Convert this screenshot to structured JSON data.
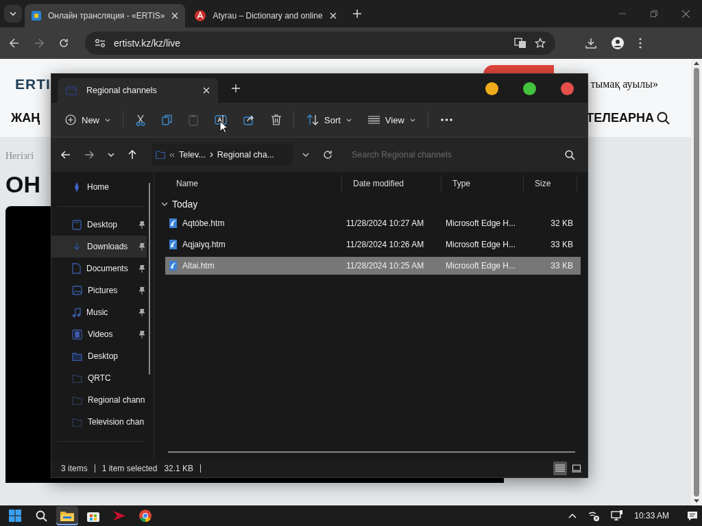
{
  "browser": {
    "tabs": [
      {
        "title": "Онлайн трансляция - «ERTIS»",
        "selected": true
      },
      {
        "title": "Atyrau – Dictionary and online",
        "selected": false
      }
    ],
    "url": "ertistv.kz/kz/live"
  },
  "page": {
    "logo": "ERTI",
    "headline": "тымақ ауылы»",
    "nav_left": "ЖАҢ",
    "nav_right": "ТЕЛЕАРНА",
    "breadcrumb": "Негізгі",
    "heading": "ОН"
  },
  "explorer": {
    "tab_title": "Regional channels",
    "commands": [
      {
        "kind": "new",
        "label": "New"
      },
      {
        "kind": "cut"
      },
      {
        "kind": "copy"
      },
      {
        "kind": "paste",
        "disabled": true
      },
      {
        "kind": "rename"
      },
      {
        "kind": "share"
      },
      {
        "kind": "delete"
      },
      {
        "kind": "sort",
        "label": "Sort"
      },
      {
        "kind": "view",
        "label": "View"
      },
      {
        "kind": "more"
      }
    ],
    "path": [
      "Telev...",
      "Regional cha..."
    ],
    "search": {
      "placeholder": "Search Regional channels"
    },
    "nav": [
      {
        "kind": "home",
        "label": "Home",
        "selected": false
      },
      {
        "kind": "desktop",
        "label": "Desktop",
        "pinned": true,
        "selected": false
      },
      {
        "kind": "downloads",
        "label": "Downloads",
        "pinned": true,
        "selected": true
      },
      {
        "kind": "documents",
        "label": "Documents",
        "pinned": true,
        "selected": false
      },
      {
        "kind": "pictures",
        "label": "Pictures",
        "pinned": true,
        "selected": false
      },
      {
        "kind": "music",
        "label": "Music",
        "pinned": true,
        "selected": false
      },
      {
        "kind": "videos",
        "label": "Videos",
        "pinned": true,
        "selected": false
      },
      {
        "kind": "desktop-folder",
        "label": "Desktop",
        "selected": false
      },
      {
        "kind": "folder",
        "label": "QRTC",
        "selected": false
      },
      {
        "kind": "folder",
        "label": "Regional chann",
        "selected": false
      },
      {
        "kind": "folder",
        "label": "Television chan",
        "selected": false
      }
    ],
    "columns": [
      "Name",
      "Date modified",
      "Type",
      "Size"
    ],
    "group": {
      "label": "Today",
      "expanded": true
    },
    "files": [
      {
        "name": "Aqtóbe.htm",
        "date": "11/28/2024 10:27 AM",
        "type": "Microsoft Edge H...",
        "size": "32 KB",
        "selected": false
      },
      {
        "name": "Aqjaiyq.htm",
        "date": "11/28/2024 10:26 AM",
        "type": "Microsoft Edge H...",
        "size": "33 KB",
        "selected": false
      },
      {
        "name": "Altai.htm",
        "date": "11/28/2024 10:25 AM",
        "type": "Microsoft Edge H...",
        "size": "33 KB",
        "selected": true
      }
    ],
    "status": {
      "count": "3 items",
      "selection": "1 item selected",
      "size": "32.1 KB"
    },
    "views": [
      {
        "kind": "details",
        "selected": true
      },
      {
        "kind": "tiles",
        "selected": false
      }
    ]
  },
  "taskbar": {
    "apps": [
      {
        "kind": "start",
        "active": false
      },
      {
        "kind": "search",
        "active": false
      },
      {
        "kind": "explorer",
        "active": true
      },
      {
        "kind": "store",
        "active": false
      },
      {
        "kind": "arrow-app",
        "active": false
      },
      {
        "kind": "chrome",
        "active": false
      }
    ],
    "time": "10:33 AM"
  }
}
